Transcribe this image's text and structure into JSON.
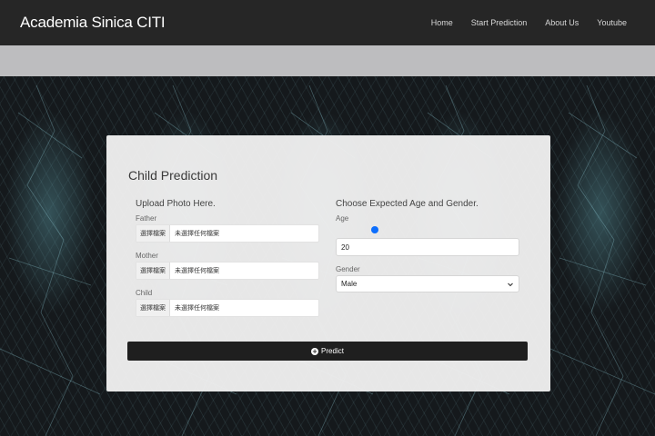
{
  "navbar": {
    "brand": "Academia Sinica CITI",
    "links": [
      "Home",
      "Start Prediction",
      "About Us",
      "Youtube"
    ]
  },
  "card": {
    "title": "Child Prediction",
    "upload": {
      "heading": "Upload Photo Here.",
      "fields": [
        {
          "label": "Father",
          "button": "選擇檔案",
          "status": "未選擇任何檔案"
        },
        {
          "label": "Mother",
          "button": "選擇檔案",
          "status": "未選擇任何檔案"
        },
        {
          "label": "Child",
          "button": "選擇檔案",
          "status": "未選擇任何檔案"
        }
      ]
    },
    "expected": {
      "heading": "Choose Expected Age and Gender.",
      "age_label": "Age",
      "age_slider_fraction": 0.2,
      "age_value": "20",
      "gender_label": "Gender",
      "gender_value": "Male"
    },
    "predict_label": "Predict",
    "predict_icon": "plus-circle-icon"
  },
  "colors": {
    "navbar": "#262626",
    "band": "#bdbdbf",
    "accent": "#0d6efd",
    "button": "#1f1f1f"
  }
}
